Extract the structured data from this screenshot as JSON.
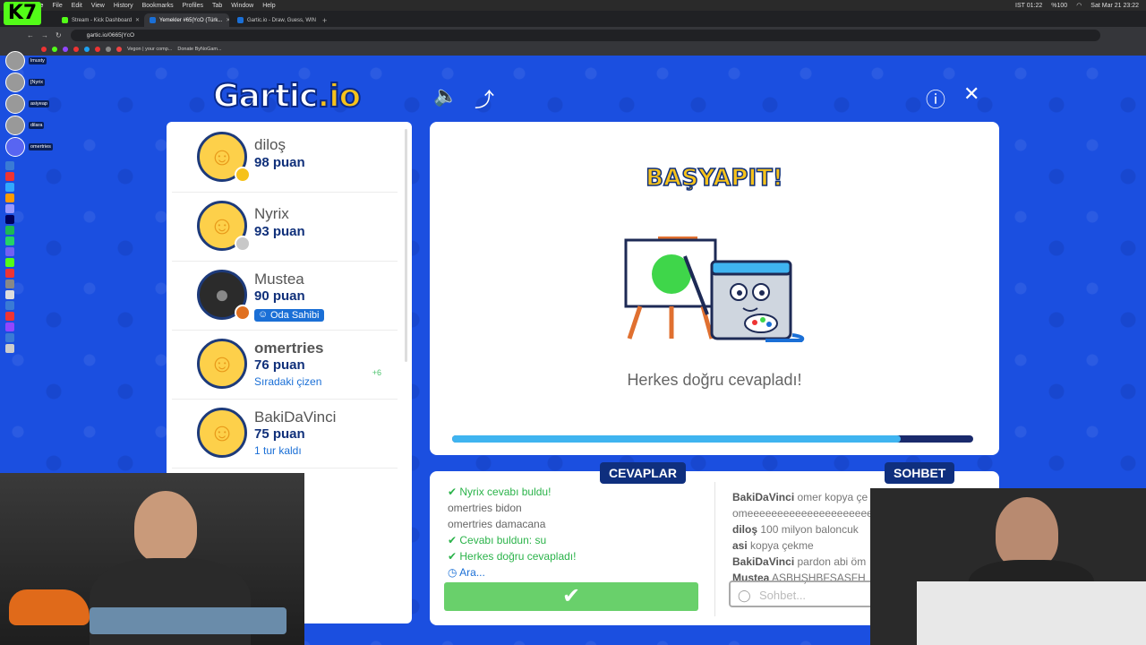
{
  "os": {
    "menu": [
      "Chrome",
      "File",
      "Edit",
      "View",
      "History",
      "Bookmarks",
      "Profiles",
      "Tab",
      "Window",
      "Help"
    ],
    "clock": "Sat Mar 21  23:22",
    "ist_time": "IST 01:22",
    "battery": "%100"
  },
  "browser": {
    "tabs": [
      {
        "title": "Stream - Kick Dashboard",
        "color": "#53fc18"
      },
      {
        "title": "Yemekler #65|YcO (Türk...",
        "color": "#1a6fd6"
      },
      {
        "title": "Gartic.io - Draw, Guess, WIN",
        "color": "#1a6fd6"
      }
    ],
    "url": "gartic.io/0665|YcO",
    "bookmarks": [
      "Vegon | your comp...",
      "Donate ByNoGam..."
    ]
  },
  "kick_logo": "K7",
  "viewers": [
    "lmusty",
    "[Nyrix",
    "asiyeap",
    "dilara",
    "omertries"
  ],
  "game": {
    "logo_part1": "Gartic",
    "logo_part2": ".io",
    "players": [
      {
        "name": "diloş",
        "points": "98 puan",
        "medal": "#f6c21b",
        "sub": "",
        "badge": "",
        "plus": ""
      },
      {
        "name": "Nyrix",
        "points": "93 puan",
        "medal": "#c8c8c8",
        "sub": "",
        "badge": "",
        "plus": ""
      },
      {
        "name": "Mustea",
        "points": "90 puan",
        "medal": "#e07020",
        "sub": "",
        "badge": "Oda Sahibi",
        "plus": ""
      },
      {
        "name": "omertries",
        "points": "76 puan",
        "medal": "",
        "sub": "Sıradaki çizen",
        "badge": "",
        "plus": "+6"
      },
      {
        "name": "BakiDaVinci",
        "points": "75 puan",
        "medal": "",
        "sub": "1 tur kaldı",
        "badge": "",
        "plus": ""
      }
    ],
    "result_title": "BAŞYAPIT!",
    "result_message": "Herkes doğru cevapladı!",
    "progress": 0.86,
    "answers_tab": "CEVAPLAR",
    "chat_tab": "SOHBET",
    "answers": [
      {
        "text": "Nyrix cevabı buldu!",
        "kind": "ok"
      },
      {
        "text": "omertries bidon",
        "kind": "n"
      },
      {
        "text": "omertries damacana",
        "kind": "n"
      },
      {
        "text": "Cevabı buldun: su",
        "kind": "ok"
      },
      {
        "text": "Herkes doğru cevapladı!",
        "kind": "ok"
      },
      {
        "text": "Ara...",
        "kind": "wait"
      }
    ],
    "chat": [
      {
        "user": "BakiDaVinci",
        "text": "omer kopya çe"
      },
      {
        "user": "",
        "text": "omeeeeeeeeeeeeeeeeeeeeeeee"
      },
      {
        "user": "diloş",
        "text": "100 milyon baloncuk"
      },
      {
        "user": "asi",
        "text": "kopya çekme"
      },
      {
        "user": "BakiDaVinci",
        "text": "pardon abi öm"
      },
      {
        "user": "Mustea",
        "text": "ASBHŞHBFSASFH"
      }
    ],
    "chat_placeholder": "Sohbet...",
    "confirm_symbol": "✔"
  }
}
